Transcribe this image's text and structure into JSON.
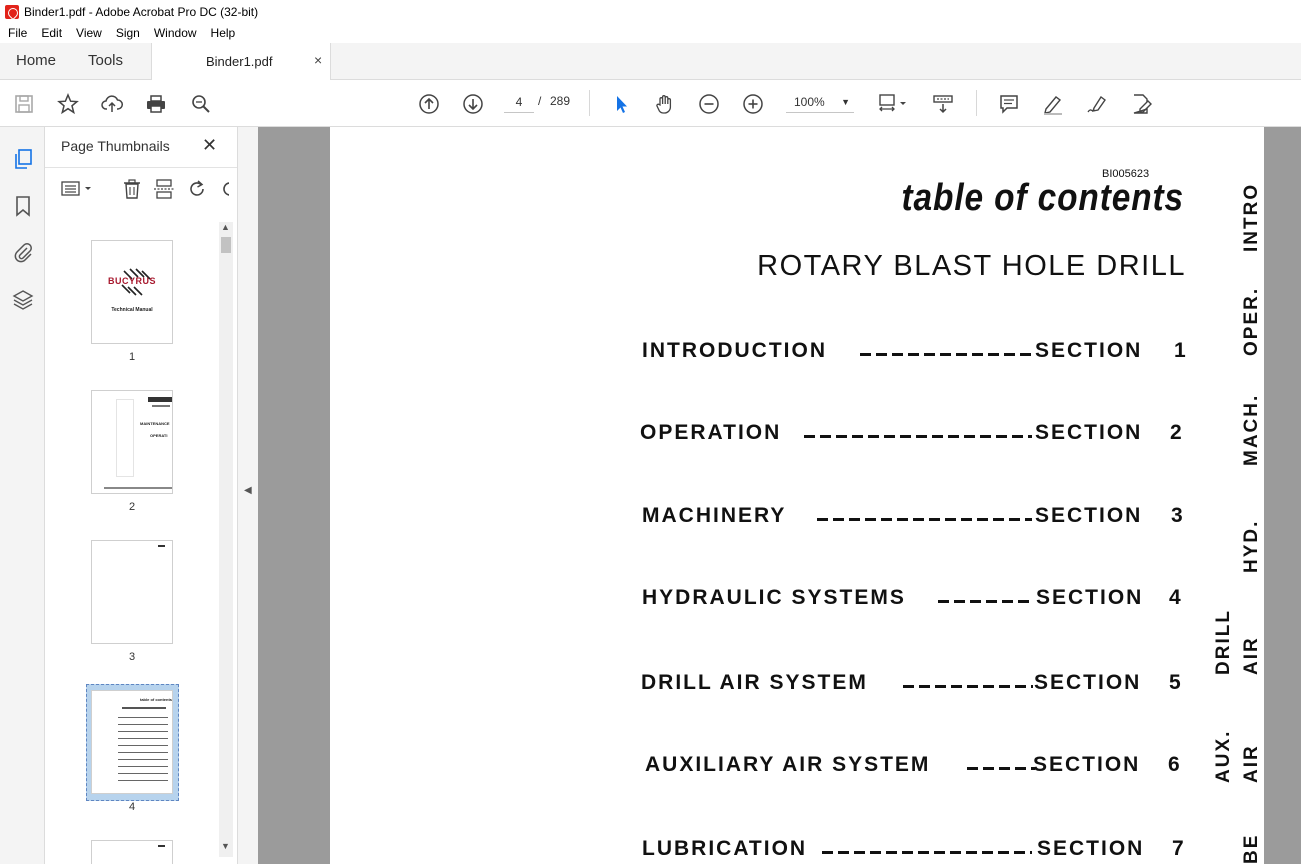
{
  "window": {
    "title": "Binder1.pdf - Adobe Acrobat Pro DC (32-bit)"
  },
  "menu": [
    "File",
    "Edit",
    "View",
    "Sign",
    "Window",
    "Help"
  ],
  "tabs": {
    "home": "Home",
    "tools": "Tools",
    "document": "Binder1.pdf",
    "close": "×"
  },
  "toolbar": {
    "current_page": "4",
    "separator": "/",
    "total_pages": "289",
    "zoom": "100%"
  },
  "thumbnails_panel": {
    "title": "Page Thumbnails",
    "close": "✕",
    "pages": [
      {
        "label": "1",
        "heading": "BUCYRUS",
        "caption": "Technical Manual"
      },
      {
        "label": "2",
        "heading": "MAINTENANCE",
        "caption": "OPERATI"
      },
      {
        "label": "3"
      },
      {
        "label": "4",
        "heading": "table of contents"
      }
    ]
  },
  "page": {
    "code": "BI005623",
    "title": "table of contents",
    "subtitle": "ROTARY BLAST HOLE DRILL",
    "toc": [
      {
        "name": "INTRODUCTION",
        "section": "SECTION",
        "number": "1"
      },
      {
        "name": "OPERATION",
        "section": "SECTION",
        "number": "2"
      },
      {
        "name": "MACHINERY",
        "section": "SECTION",
        "number": "3"
      },
      {
        "name": "HYDRAULIC SYSTEMS",
        "section": "SECTION",
        "number": "4"
      },
      {
        "name": "DRILL AIR  SYSTEM",
        "section": "SECTION",
        "number": "5"
      },
      {
        "name": "AUXILIARY AIR SYSTEM",
        "section": "SECTION",
        "number": "6"
      },
      {
        "name": "LUBRICATION",
        "section": "SECTION",
        "number": "7"
      }
    ],
    "side_tabs": [
      "INTRO",
      "OPER.",
      "MACH.",
      "HYD.",
      "DRILL",
      "AIR",
      "AUX.",
      "AIR",
      "BE"
    ]
  },
  "colors": {
    "accent": "#1473e6",
    "brand_red": "#e2231a",
    "canvas": "#9b9b9b"
  }
}
